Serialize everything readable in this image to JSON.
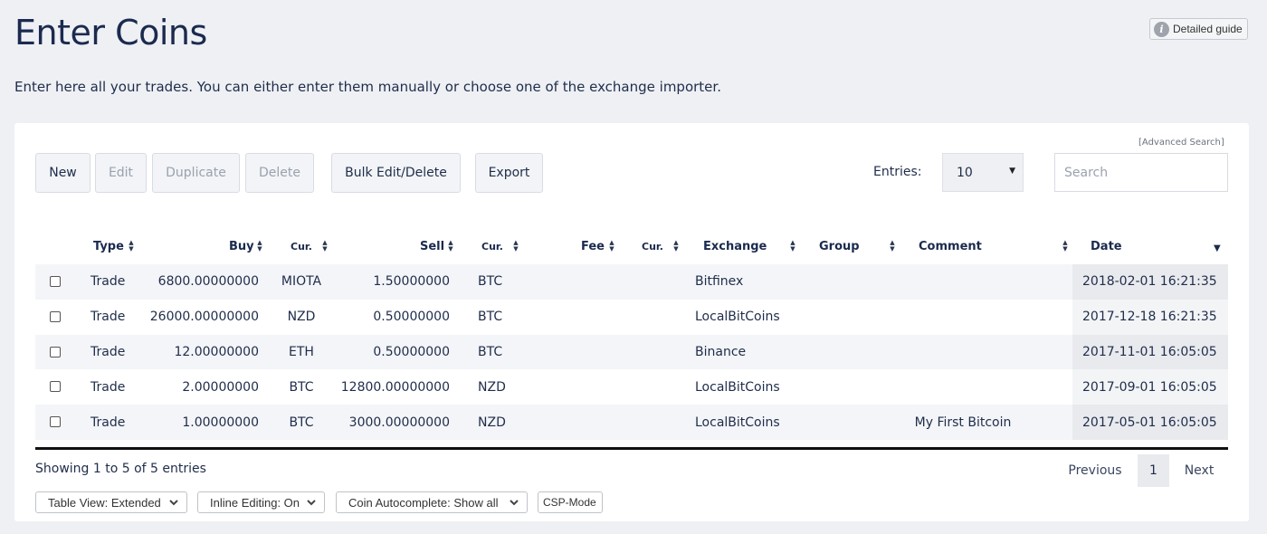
{
  "header": {
    "title": "Enter Coins",
    "guide_label": "Detailed guide",
    "guide_icon": "info-icon",
    "intro": "Enter here all your trades. You can either enter them manually or choose one of the exchange importer."
  },
  "toolbar": {
    "new_label": "New",
    "edit_label": "Edit",
    "duplicate_label": "Duplicate",
    "delete_label": "Delete",
    "bulk_label": "Bulk Edit/Delete",
    "export_label": "Export",
    "advanced_search": "[Advanced Search]",
    "entries_label": "Entries:",
    "entries_value": "10",
    "search_placeholder": "Search"
  },
  "table": {
    "headers": {
      "type": "Type",
      "buy": "Buy",
      "buy_cur": "Cur.",
      "sell": "Sell",
      "sell_cur": "Cur.",
      "fee": "Fee",
      "fee_cur": "Cur.",
      "exchange": "Exchange",
      "group": "Group",
      "comment": "Comment",
      "date": "Date"
    },
    "rows": [
      {
        "type": "Trade",
        "buy": "6800.00000000",
        "buy_cur": "MIOTA",
        "sell": "1.50000000",
        "sell_cur": "BTC",
        "fee": "",
        "fee_cur": "",
        "exchange": "Bitfinex",
        "group": "",
        "comment": "",
        "date": "2018-02-01 16:21:35"
      },
      {
        "type": "Trade",
        "buy": "26000.00000000",
        "buy_cur": "NZD",
        "sell": "0.50000000",
        "sell_cur": "BTC",
        "fee": "",
        "fee_cur": "",
        "exchange": "LocalBitCoins",
        "group": "",
        "comment": "",
        "date": "2017-12-18 16:21:35"
      },
      {
        "type": "Trade",
        "buy": "12.00000000",
        "buy_cur": "ETH",
        "sell": "0.50000000",
        "sell_cur": "BTC",
        "fee": "",
        "fee_cur": "",
        "exchange": "Binance",
        "group": "",
        "comment": "",
        "date": "2017-11-01 16:05:05"
      },
      {
        "type": "Trade",
        "buy": "2.00000000",
        "buy_cur": "BTC",
        "sell": "12800.00000000",
        "sell_cur": "NZD",
        "fee": "",
        "fee_cur": "",
        "exchange": "LocalBitCoins",
        "group": "",
        "comment": "",
        "date": "2017-09-01 16:05:05"
      },
      {
        "type": "Trade",
        "buy": "1.00000000",
        "buy_cur": "BTC",
        "sell": "3000.00000000",
        "sell_cur": "NZD",
        "fee": "",
        "fee_cur": "",
        "exchange": "LocalBitCoins",
        "group": "",
        "comment": "My First Bitcoin",
        "date": "2017-05-01 16:05:05"
      }
    ]
  },
  "footer": {
    "showing": "Showing 1 to 5 of 5 entries",
    "previous": "Previous",
    "page": "1",
    "next": "Next",
    "options": {
      "table_view": "Table View: Extended",
      "inline_editing": "Inline Editing: On",
      "coin_autocomplete": "Coin Autocomplete: Show all",
      "csp_mode": "CSP-Mode"
    }
  }
}
